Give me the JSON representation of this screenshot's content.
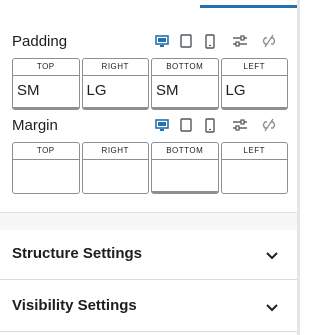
{
  "padding": {
    "title": "Padding",
    "icons": [
      "desktop-icon",
      "tablet-icon",
      "mobile-icon",
      "sliders-icon",
      "unlink-icon"
    ],
    "sides": [
      {
        "label": "TOP",
        "value": "SM"
      },
      {
        "label": "RIGHT",
        "value": "LG"
      },
      {
        "label": "BOTTOM",
        "value": "SM"
      },
      {
        "label": "LEFT",
        "value": "LG"
      }
    ]
  },
  "margin": {
    "title": "Margin",
    "icons": [
      "desktop-icon",
      "tablet-icon",
      "mobile-icon",
      "sliders-icon",
      "unlink-icon"
    ],
    "sides": [
      {
        "label": "TOP",
        "value": ""
      },
      {
        "label": "RIGHT",
        "value": ""
      },
      {
        "label": "BOTTOM",
        "value": ""
      },
      {
        "label": "LEFT",
        "value": ""
      }
    ]
  },
  "panels": [
    {
      "title": "Structure Settings"
    },
    {
      "title": "Visibility Settings"
    }
  ],
  "colors": {
    "accent": "#2271b1",
    "border": "#8c8f94",
    "text": "#1e1e1e"
  }
}
